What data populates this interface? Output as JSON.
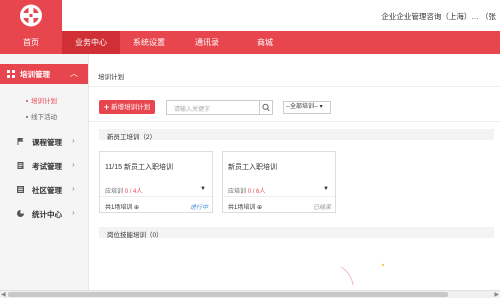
{
  "header": {
    "company": "企业企业管理咨询（上海）… （张"
  },
  "nav": {
    "items": [
      "首页",
      "业务中心",
      "系统设置",
      "通讯录",
      "商城"
    ],
    "active_index": 1
  },
  "sidebar": {
    "active_group": "培训管理",
    "sub_items": [
      "培训计划",
      "线下活动"
    ],
    "active_sub_index": 0,
    "groups": [
      "课程管理",
      "考试管理",
      "社区管理",
      "统计中心"
    ]
  },
  "main": {
    "breadcrumb": "培训计划",
    "add_button": "新增培训计划",
    "search_placeholder": "请输入关键字",
    "filter_selected": "--全部培训--",
    "sections": [
      {
        "label": "新员工培训（2）"
      },
      {
        "label": "岗位技能培训（0）"
      }
    ],
    "cards": [
      {
        "title": "11/15 新员工入职培训",
        "stat_prefix": "应培训",
        "stat_value": "0 / 4人",
        "footer": "共1场培训",
        "status": "进行中",
        "status_color": "#4a8fd6"
      },
      {
        "title": "新员工入职培训",
        "stat_prefix": "应培训",
        "stat_value": "0 / 6人",
        "footer": "共1场培训",
        "status": "已结束",
        "status_color": "#999999"
      }
    ]
  },
  "colors": {
    "accent": "#e8464e",
    "accent_dark": "#d02f36"
  }
}
